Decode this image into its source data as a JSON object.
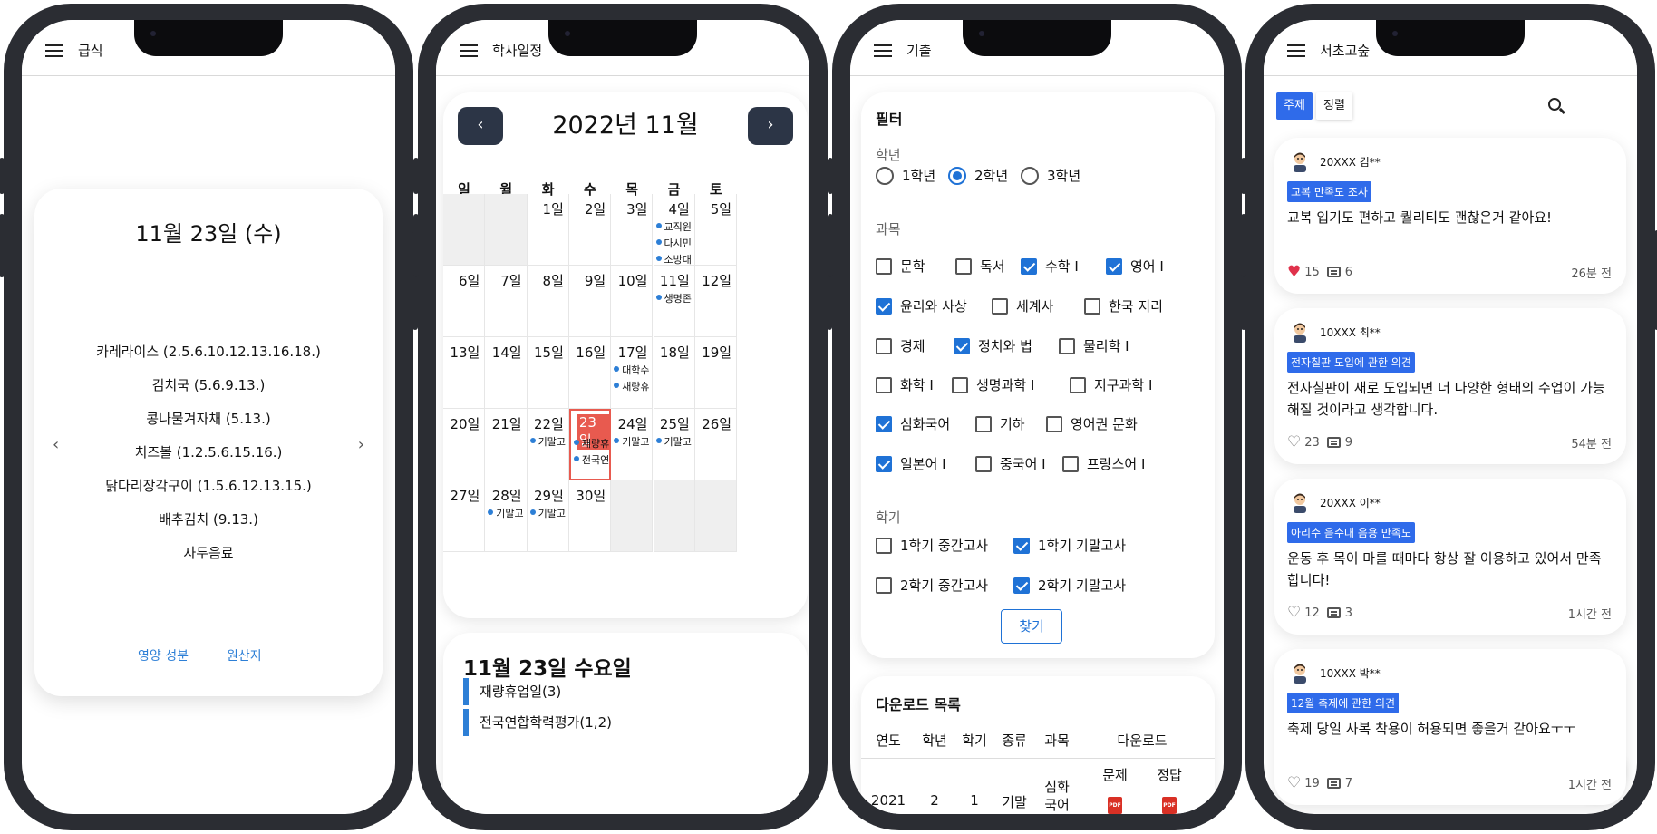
{
  "phone1": {
    "title": "급식",
    "date": "11월 23일 (수)",
    "menu": [
      "카레라이스 (2.5.6.10.12.13.16.18.)",
      "김치국 (5.6.9.13.)",
      "콩나물겨자채 (5.13.)",
      "치즈볼 (1.2.5.6.15.16.)",
      "닭다리장각구이 (1.5.6.12.13.15.)",
      "배추김치 (9.13.)",
      "자두음료"
    ],
    "nutrition_label": "영양 성분",
    "origin_label": "원산지",
    "prev": "‹",
    "next": "›"
  },
  "phone2": {
    "title": "학사일정",
    "month": "2022년 11월",
    "prev": "‹",
    "next": "›",
    "weekdays": [
      "일",
      "월",
      "화",
      "수",
      "목",
      "금",
      "토"
    ],
    "days": [
      "1일",
      "2일",
      "3일",
      "4일",
      "5일",
      "6일",
      "7일",
      "8일",
      "9일",
      "10일",
      "11일",
      "12일",
      "13일",
      "14일",
      "15일",
      "16일",
      "17일",
      "18일",
      "19일",
      "20일",
      "21일",
      "22일",
      "23일",
      "24일",
      "25일",
      "26일",
      "27일",
      "28일",
      "29일",
      "30일"
    ],
    "events": {
      "4": [
        "교직원",
        "다시민",
        "소방대"
      ],
      "11": [
        "생명존"
      ],
      "17": [
        "대학수",
        "재량휴"
      ],
      "22": [
        "기말고"
      ],
      "23": [
        "재량휴",
        "전국연"
      ],
      "24": [
        "기말고"
      ],
      "25": [
        "기말고"
      ],
      "28": [
        "기말고"
      ],
      "29": [
        "기말고"
      ]
    },
    "selected_title": "11월 23일 수요일",
    "selected_events": [
      "재량휴업일(3)",
      "전국연합학력평가(1,2)"
    ]
  },
  "phone3": {
    "title": "기출",
    "filter_title": "필터",
    "grade_label": "학년",
    "grades": [
      {
        "label": "1학년",
        "on": false
      },
      {
        "label": "2학년",
        "on": true
      },
      {
        "label": "3학년",
        "on": false
      }
    ],
    "subject_label": "과목",
    "subjects": [
      [
        {
          "label": "문학",
          "on": false
        },
        {
          "label": "독서",
          "on": false
        },
        {
          "label": "수학 I",
          "on": true
        },
        {
          "label": "영어 I",
          "on": true
        }
      ],
      [
        {
          "label": "윤리와 사상",
          "on": true
        },
        {
          "label": "세계사",
          "on": false
        },
        {
          "label": "한국 지리",
          "on": false
        }
      ],
      [
        {
          "label": "경제",
          "on": false
        },
        {
          "label": "정치와 법",
          "on": true
        },
        {
          "label": "물리학 I",
          "on": false
        }
      ],
      [
        {
          "label": "화학 I",
          "on": false
        },
        {
          "label": "생명과학 I",
          "on": false
        },
        {
          "label": "지구과학 I",
          "on": false
        }
      ],
      [
        {
          "label": "심화국어",
          "on": true
        },
        {
          "label": "기하",
          "on": false
        },
        {
          "label": "영어권 문화",
          "on": false
        }
      ],
      [
        {
          "label": "일본어 I",
          "on": true
        },
        {
          "label": "중국어 I",
          "on": false
        },
        {
          "label": "프랑스어 I",
          "on": false
        }
      ]
    ],
    "term_label": "학기",
    "terms": [
      [
        {
          "label": "1학기 중간고사",
          "on": false
        },
        {
          "label": "1학기 기말고사",
          "on": true
        }
      ],
      [
        {
          "label": "2학기 중간고사",
          "on": false
        },
        {
          "label": "2학기 기말고사",
          "on": true
        }
      ]
    ],
    "find_label": "찾기",
    "download_title": "다운로드 목록",
    "columns": [
      "연도",
      "학년",
      "학기",
      "종류",
      "과목",
      "다운로드"
    ],
    "sub_columns": [
      "문제",
      "정답"
    ],
    "rows": [
      {
        "year": "2021",
        "grade": "2",
        "term": "1",
        "kind": "기말",
        "subject_line1": "심화",
        "subject_line2": "국어"
      }
    ],
    "pdf_text": "PDF"
  },
  "phone4": {
    "title": "서초고숲",
    "tab_topic": "주제",
    "tab_sort": "정렬",
    "posts": [
      {
        "author": "20XXX 김**",
        "tag": "교복 만족도 조사",
        "text": "교복 입기도 편하고 퀄리티도 괜찮은거 같아요!",
        "likes": "15",
        "comments": "6",
        "time": "26분 전",
        "liked": true
      },
      {
        "author": "10XXX 최**",
        "tag": "전자칠판 도입에 관한 의견",
        "text": "전자칠판이 새로 도입되면 더 다양한 형태의 수업이 가능해질 것이라고 생각합니다.",
        "likes": "23",
        "comments": "9",
        "time": "54분 전",
        "liked": false
      },
      {
        "author": "20XXX 이**",
        "tag": "아리수 음수대 음용 만족도",
        "text": "운동 후 목이 마를 때마다 항상 잘 이용하고 있어서 만족합니다!",
        "likes": "12",
        "comments": "3",
        "time": "1시간 전",
        "liked": false
      },
      {
        "author": "10XXX 박**",
        "tag": "12월 축제에 관한 의견",
        "text": "축제 당일 사복 착용이 허용되면 좋을거 같아요ㅜㅜ",
        "likes": "19",
        "comments": "7",
        "time": "1시간 전",
        "liked": false
      }
    ]
  },
  "colors": {
    "accent": "#2f6bea",
    "calendar_button": "#2c3546",
    "today": "#e85a4f",
    "event_dot": "#2d7fd6",
    "like": "#e0314b"
  }
}
